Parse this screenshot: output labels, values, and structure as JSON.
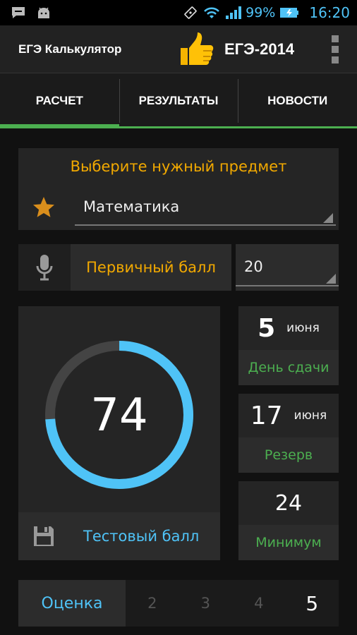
{
  "status_bar": {
    "battery_text": "99%",
    "time": "16:20",
    "icons": [
      "chat-icon",
      "android-icon",
      "rotate-icon",
      "wifi-icon",
      "signal-icon",
      "battery-icon"
    ]
  },
  "action_bar": {
    "title": "ЕГЭ Калькулятор",
    "year_label": "ЕГЭ-2014",
    "icons": [
      "thumbs-up-icon",
      "overflow-menu-icon"
    ]
  },
  "tabs": [
    {
      "label": "РАСЧЕТ",
      "active": true
    },
    {
      "label": "РЕЗУЛЬТАТЫ",
      "active": false
    },
    {
      "label": "НОВОСТИ",
      "active": false
    }
  ],
  "subject": {
    "header": "Выберите нужный предмет",
    "selected": "Математика"
  },
  "primary": {
    "label": "Первичный балл",
    "value": "20"
  },
  "gauge": {
    "value": "74",
    "fraction": 0.74,
    "footer_label": "Тестовый балл"
  },
  "info": {
    "exam_day": "5",
    "exam_month": "июня",
    "exam_label": "День сдачи",
    "reserve_day": "17",
    "reserve_month": "июня",
    "reserve_label": "Резерв",
    "minimum_value": "24",
    "minimum_label": "Минимум"
  },
  "grade": {
    "label": "Оценка",
    "options": [
      "2",
      "3",
      "4",
      "5"
    ],
    "selected": "5"
  },
  "colors": {
    "accent_orange": "#f2a900",
    "accent_blue": "#4fc3f7",
    "accent_green": "#4caf50"
  }
}
